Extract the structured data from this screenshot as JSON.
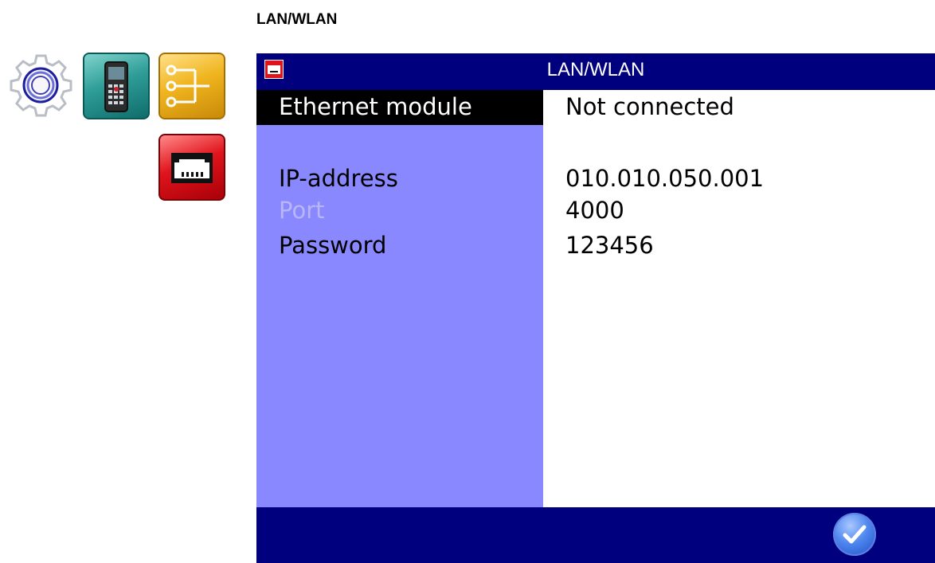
{
  "heading": "LAN/WLAN",
  "icons": {
    "settings": "gear-icon",
    "device": "handheld-device-icon",
    "network": "network-tree-icon",
    "lan": "ethernet-port-icon"
  },
  "colors": {
    "titlebar": "#00007f",
    "left_panel": "#8a88ff",
    "selected_row": "#000000",
    "lan_tile": "#e0141c",
    "network_tile": "#f0b51f",
    "device_tile": "#2f9d98"
  },
  "screen": {
    "title": "LAN/WLAN",
    "rows": [
      {
        "label": "Ethernet module",
        "value": "Not connected",
        "selected": true
      },
      {
        "label": "IP-address",
        "value": "010.010.050.001"
      },
      {
        "label": "Port",
        "value": "4000",
        "disabled": true
      },
      {
        "label": "Password",
        "value": "123456"
      }
    ]
  },
  "footer": {
    "confirm_icon": "checkmark-icon"
  }
}
